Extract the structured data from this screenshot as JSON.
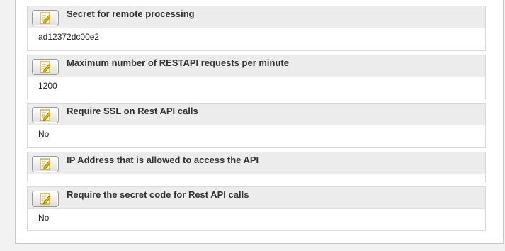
{
  "settings": [
    {
      "title": "Secret for remote processing",
      "value": "ad12372dc00e2"
    },
    {
      "title": "Maximum number of RESTAPI requests per minute",
      "value": "1200"
    },
    {
      "title": "Require SSL on Rest API calls",
      "value": "No"
    },
    {
      "title": "IP Address that is allowed to access the API",
      "value": ""
    },
    {
      "title": "Require the secret code for Rest API calls",
      "value": "No"
    }
  ],
  "icons": {
    "edit": "edit-note-icon"
  },
  "colors": {
    "header_bg": "#ececec",
    "icon_accent": "#d9b400"
  }
}
